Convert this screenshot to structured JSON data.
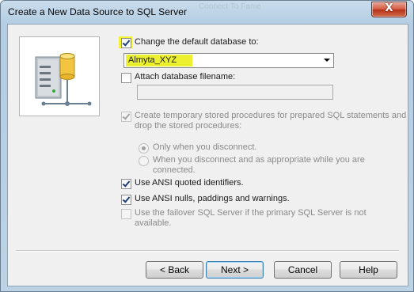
{
  "window": {
    "title": "Create a New Data Source to SQL Server",
    "ghost_title": "Connect To Fame",
    "close_glyph": "X"
  },
  "options": {
    "change_default_db": {
      "label": "Change the default database to:",
      "checked": true
    },
    "default_db_value": "Almyta_XYZ",
    "attach_db": {
      "label": "Attach database filename:",
      "checked": false
    },
    "attach_db_value": "",
    "temp_procs": {
      "line1": "Create temporary stored procedures for prepared SQL statements and",
      "line2": "drop the stored procedures:",
      "checked": true
    },
    "radio_only_when": {
      "label": "Only when you disconnect.",
      "selected": true
    },
    "radio_when_and": {
      "line1": "When you disconnect and as appropriate while you are",
      "line2": "connected.",
      "selected": false
    },
    "ansi_quoted": {
      "label": "Use ANSI quoted identifiers.",
      "checked": true
    },
    "ansi_nulls": {
      "label": "Use ANSI nulls, paddings and warnings.",
      "checked": true
    },
    "failover": {
      "line1": "Use the failover SQL Server if the primary SQL Server is not",
      "line2": "available.",
      "checked": false
    }
  },
  "buttons": {
    "back": "< Back",
    "next": "Next >",
    "cancel": "Cancel",
    "help": "Help"
  },
  "colors": {
    "highlight": "#f4f23a",
    "titlebar": "#c9dcec",
    "close": "#c74a2e"
  }
}
